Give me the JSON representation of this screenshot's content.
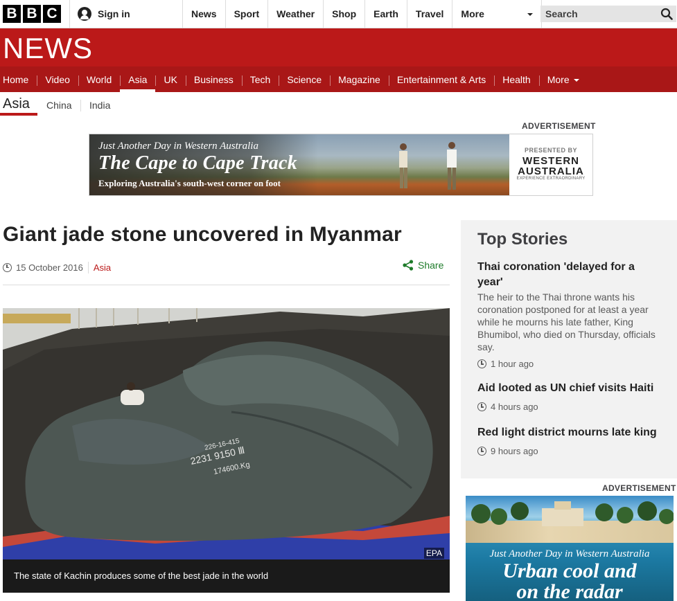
{
  "brand": {
    "letters": [
      "B",
      "B",
      "C"
    ]
  },
  "account": {
    "signin_label": "Sign in"
  },
  "global_nav": {
    "items": [
      "News",
      "Sport",
      "Weather",
      "Shop",
      "Earth",
      "Travel"
    ],
    "more_label": "More"
  },
  "search": {
    "placeholder": "Search"
  },
  "masthead": {
    "title": "NEWS"
  },
  "news_nav": {
    "items": [
      "Home",
      "Video",
      "World",
      "Asia",
      "UK",
      "Business",
      "Tech",
      "Science",
      "Magazine",
      "Entertainment & Arts",
      "Health"
    ],
    "active": "Asia",
    "more_label": "More"
  },
  "subnav": {
    "current": "Asia",
    "items": [
      "China",
      "India"
    ]
  },
  "advertisement_label": "ADVERTISEMENT",
  "banner_ad": {
    "tagline": "Just Another Day in Western Australia",
    "headline": "The Cape to Cape Track",
    "subline": "Exploring Australia's south-west corner on foot",
    "presented_by": "PRESENTED BY",
    "brand": "WESTERN AUSTRALIA",
    "brand_tag": "EXPERIENCE EXTRAORDINARY"
  },
  "article": {
    "headline": "Giant jade stone uncovered in Myanmar",
    "date": "15 October 2016",
    "category": "Asia",
    "share_label": "Share",
    "image_credit": "EPA",
    "caption": "The state of Kachin produces some of the best jade in the world",
    "stone_markings": [
      "226-16-415",
      "2231 9150 Ⅲ",
      "174600.Kg"
    ]
  },
  "top_stories": {
    "title": "Top Stories",
    "items": [
      {
        "headline": "Thai coronation 'delayed for a year'",
        "summary": "The heir to the Thai throne wants his coronation postponed for at least a year while he mourns his late father, King Bhumibol, who died on Thursday, officials say.",
        "time": "1 hour ago"
      },
      {
        "headline": "Aid looted as UN chief visits Haiti",
        "time": "4 hours ago"
      },
      {
        "headline": "Red light district mourns late king",
        "time": "9 hours ago"
      }
    ]
  },
  "side_ad": {
    "tagline": "Just Another Day in Western Australia",
    "headline_line1": "Urban cool and",
    "headline_line2": "on the radar"
  },
  "colors": {
    "bbc_red": "#bb1919",
    "nav_red": "#a91717",
    "share_green": "#1e7b2a",
    "sidebar_bg": "#f2f2f2"
  }
}
